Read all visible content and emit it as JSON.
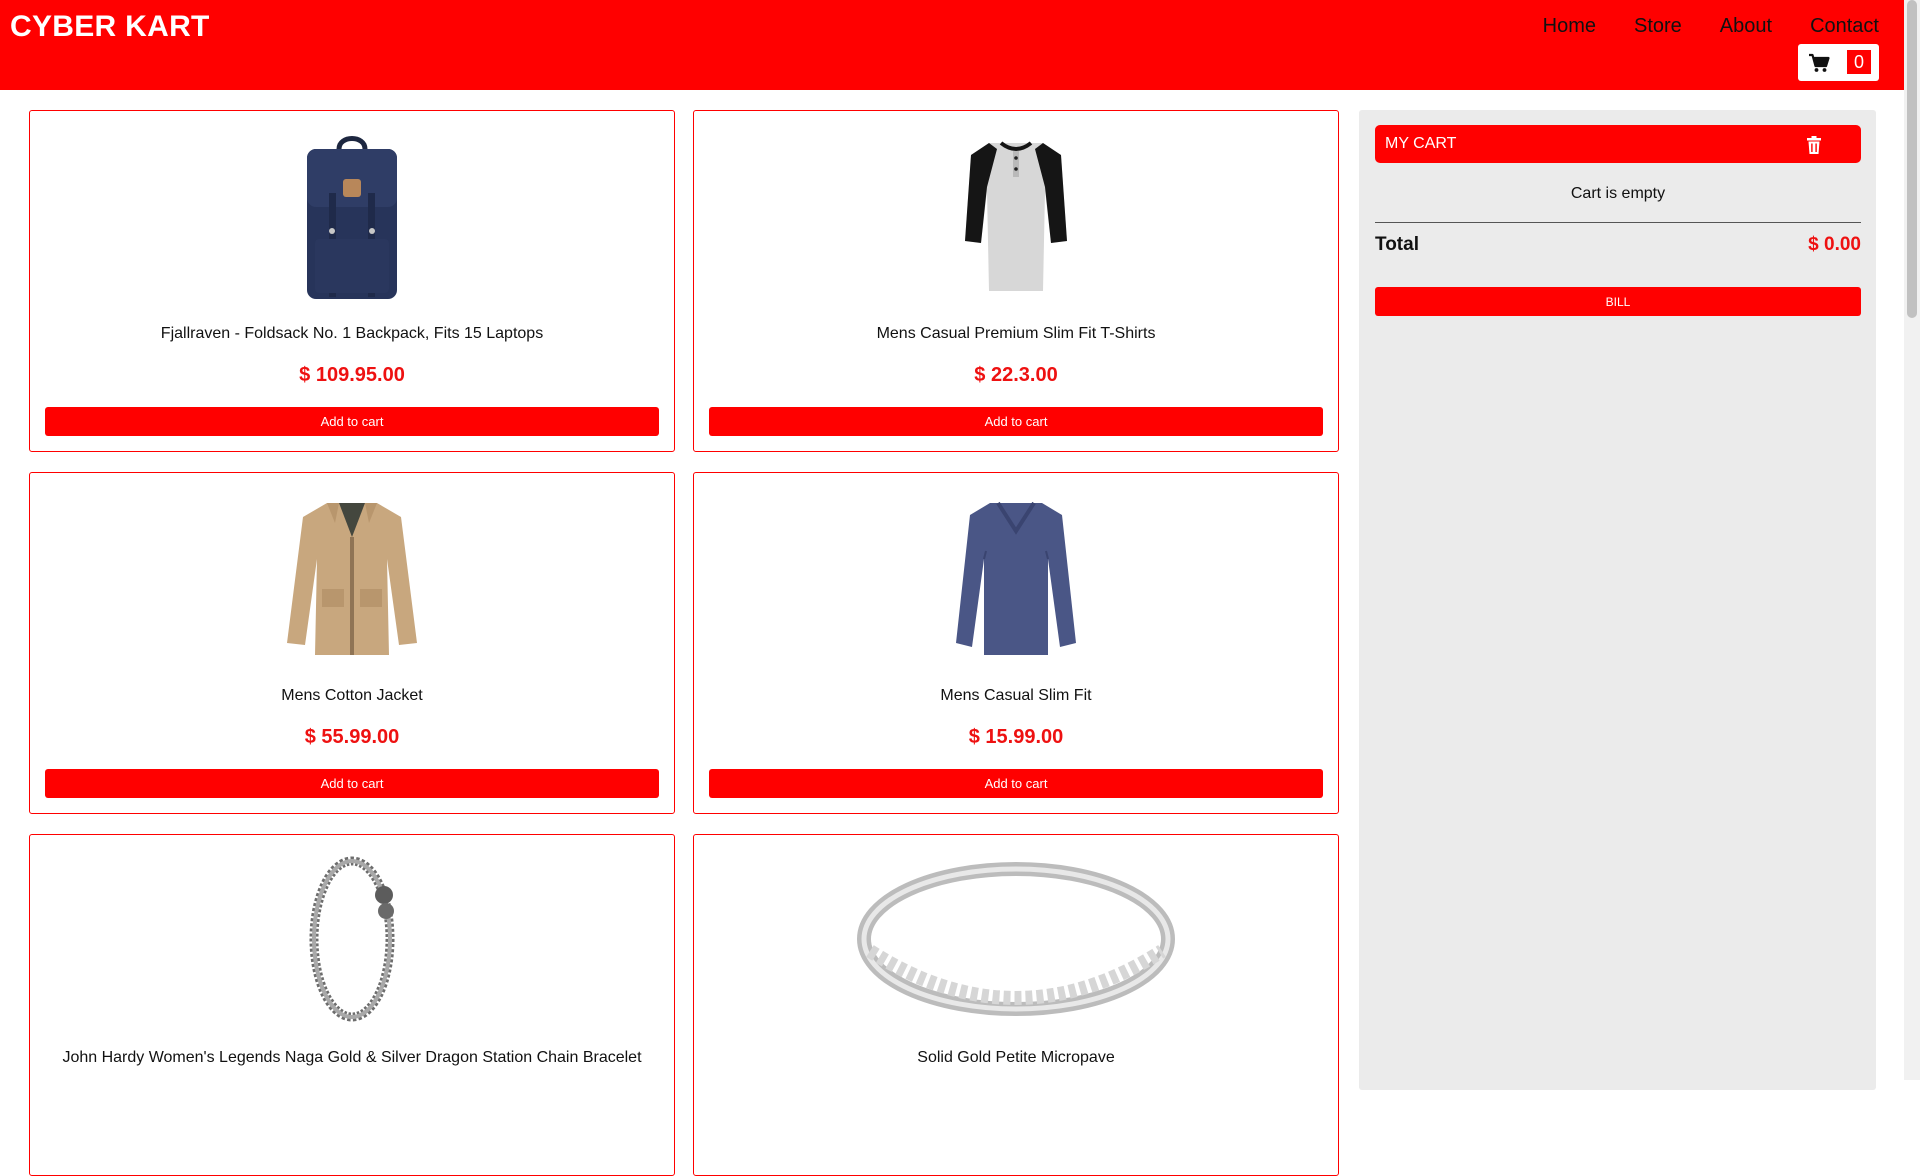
{
  "brand": "CYBER KART",
  "nav": {
    "links": [
      "Home",
      "Store",
      "About",
      "Contact"
    ],
    "cart_count": "0",
    "cart_icon": "shopping-cart-icon"
  },
  "products": [
    {
      "title": "Fjallraven - Foldsack No. 1 Backpack, Fits 15 Laptops",
      "price": "$ 109.95.00",
      "button": "Add to cart",
      "image": "navy-backpack-image"
    },
    {
      "title": "Mens Casual Premium Slim Fit T-Shirts",
      "price": "$ 22.3.00",
      "button": "Add to cart",
      "image": "raglan-tshirt-image"
    },
    {
      "title": "Mens Cotton Jacket",
      "price": "$ 55.99.00",
      "button": "Add to cart",
      "image": "khaki-jacket-image"
    },
    {
      "title": "Mens Casual Slim Fit",
      "price": "$ 15.99.00",
      "button": "Add to cart",
      "image": "navy-longsleeve-image"
    },
    {
      "title": "John Hardy Women's Legends Naga Gold & Silver Dragon Station Chain Bracelet",
      "price": "",
      "button": "",
      "image": "dragon-bracelet-image"
    },
    {
      "title": "Solid Gold Petite Micropave",
      "price": "",
      "button": "",
      "image": "silver-ring-image"
    }
  ],
  "cart": {
    "title": "MY CART",
    "trash_icon": "trash-icon",
    "empty_message": "Cart is empty",
    "total_label": "Total",
    "total_value": "$ 0.00",
    "bill_button": "BILL"
  },
  "colors": {
    "accent": "#ff0000",
    "price": "#ee1111",
    "panel": "#ebebeb"
  }
}
